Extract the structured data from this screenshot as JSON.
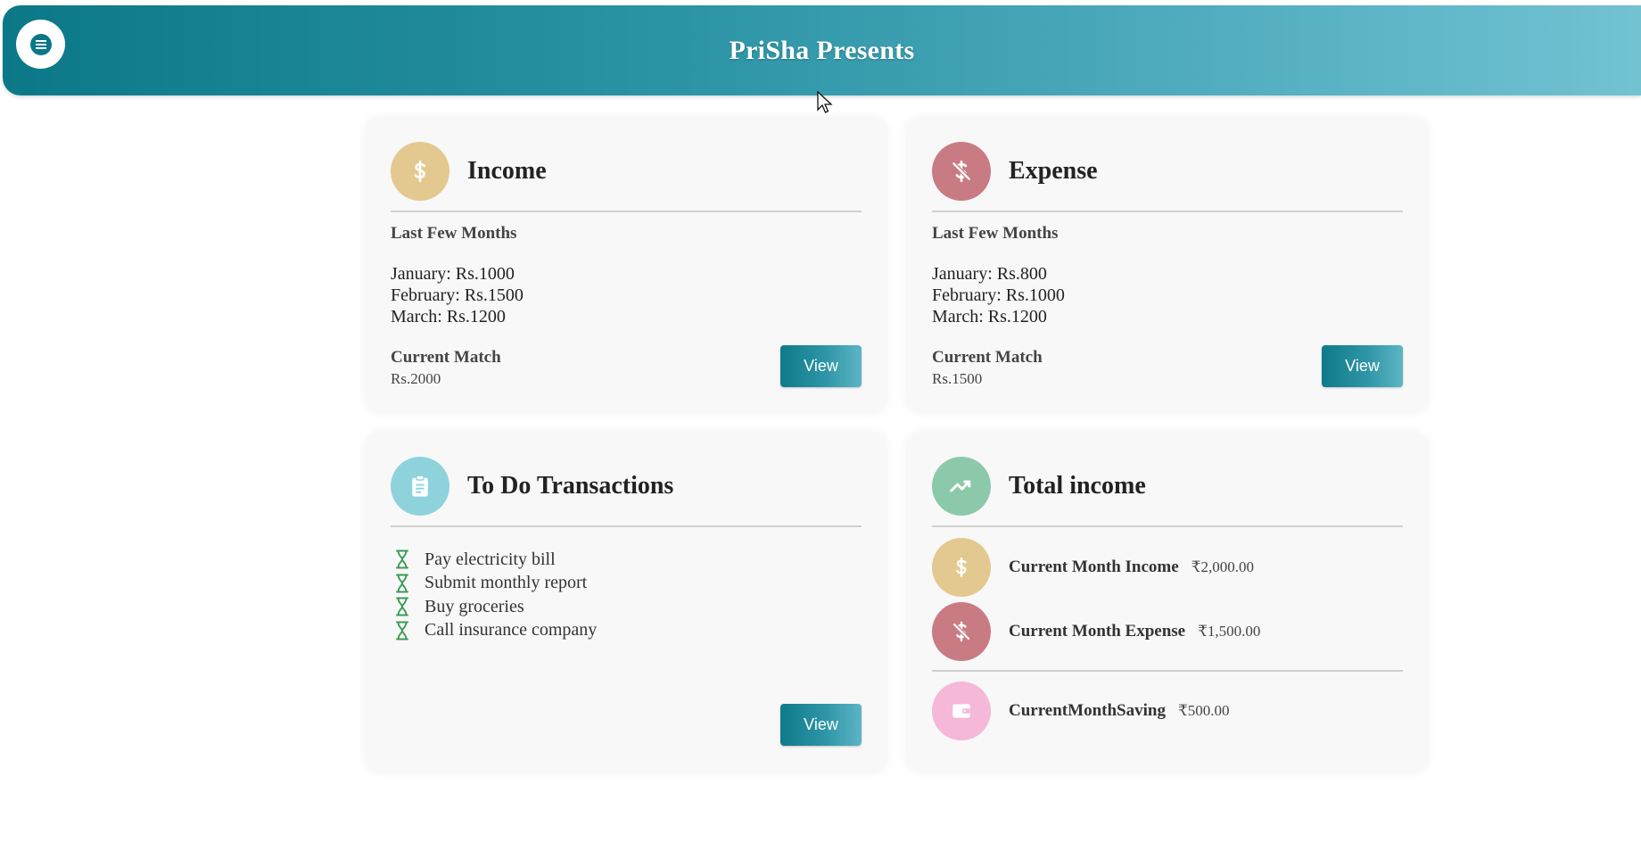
{
  "header": {
    "title": "PriSha Presents",
    "menu_icon": "hamburger-menu-icon",
    "gradient": [
      "#0b7888",
      "#72c2d2"
    ]
  },
  "income": {
    "title": "Income",
    "icon": "dollar-icon",
    "icon_color": "#e3c98f",
    "subtitle": "Last Few Months",
    "months": [
      {
        "text": "January: Rs.1000"
      },
      {
        "text": "February: Rs.1500"
      },
      {
        "text": "March: Rs.1200"
      }
    ],
    "current_label": "Current Match",
    "current_value": "Rs.2000",
    "button": "View"
  },
  "expense": {
    "title": "Expense",
    "icon": "dollar-off-icon",
    "icon_color": "#c97b84",
    "subtitle": "Last Few Months",
    "months": [
      {
        "text": "January: Rs.800"
      },
      {
        "text": "February: Rs.1000"
      },
      {
        "text": "March: Rs.1200"
      }
    ],
    "current_label": "Current Match",
    "current_value": "Rs.1500",
    "button": "View"
  },
  "todo": {
    "title": "To Do Transactions",
    "icon": "clipboard-icon",
    "icon_color": "#8ed3dc",
    "items": [
      {
        "text": "Pay electricity bill"
      },
      {
        "text": "Submit monthly report"
      },
      {
        "text": "Buy groceries"
      },
      {
        "text": "Call insurance company"
      }
    ],
    "item_icon": "hourglass-icon",
    "button": "View"
  },
  "total": {
    "title": "Total income",
    "icon": "trending-up-icon",
    "icon_color": "#8cc9aa",
    "rows": [
      {
        "label": "Current Month Income",
        "amount": "₹2,000.00",
        "icon": "dollar-icon",
        "color": "#e3c98f"
      },
      {
        "label": "Current Month Expense",
        "amount": "₹1,500.00",
        "icon": "dollar-off-icon",
        "color": "#c97b84"
      },
      {
        "label": "CurrentMonthSaving",
        "amount": "₹500.00",
        "icon": "wallet-icon",
        "color": "#f5b8d8"
      }
    ]
  }
}
